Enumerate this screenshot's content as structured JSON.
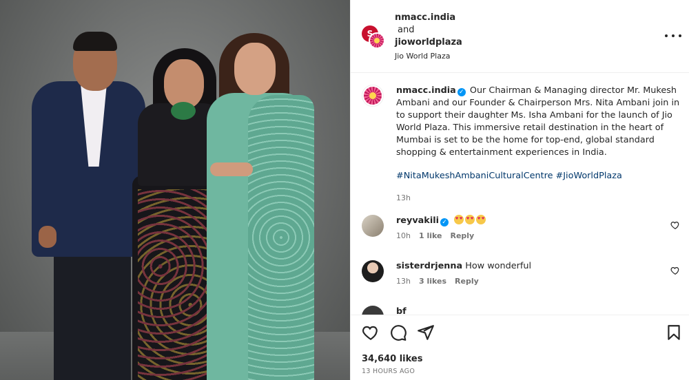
{
  "header": {
    "user1": "nmacc.india",
    "and": "and",
    "user2": "jioworldplaza",
    "location": "Jio World Plaza",
    "red_avatar_letter": "S"
  },
  "caption": {
    "username": "nmacc.india",
    "text": "Our Chairman & Managing director Mr. Mukesh Ambani and our Founder & Chairperson Mrs. Nita Ambani join in to support their daughter Ms. Isha Ambani for the launch of Jio World Plaza. This immersive retail destination in the heart of Mumbai is set to be the home for top-end, global standard shopping & entertainment experiences in India.",
    "hashtags": "#NitaMukeshAmbaniCulturalCentre #JioWorldPlaza",
    "time": "13h"
  },
  "comments": [
    {
      "username": "reyvakili",
      "text": "",
      "emoji_count": 3,
      "time": "10h",
      "likes": "1 like",
      "reply": "Reply"
    },
    {
      "username": "sisterdrjenna",
      "text": "How wonderful",
      "time": "13h",
      "likes": "3 likes",
      "reply": "Reply"
    }
  ],
  "partial_comment": {
    "username": "bf"
  },
  "footer": {
    "likes": "34,640 likes",
    "timestamp": "13 HOURS AGO"
  },
  "colors": {
    "link": "#00376b",
    "verified": "#0095f6",
    "meta_gray": "#737373"
  }
}
